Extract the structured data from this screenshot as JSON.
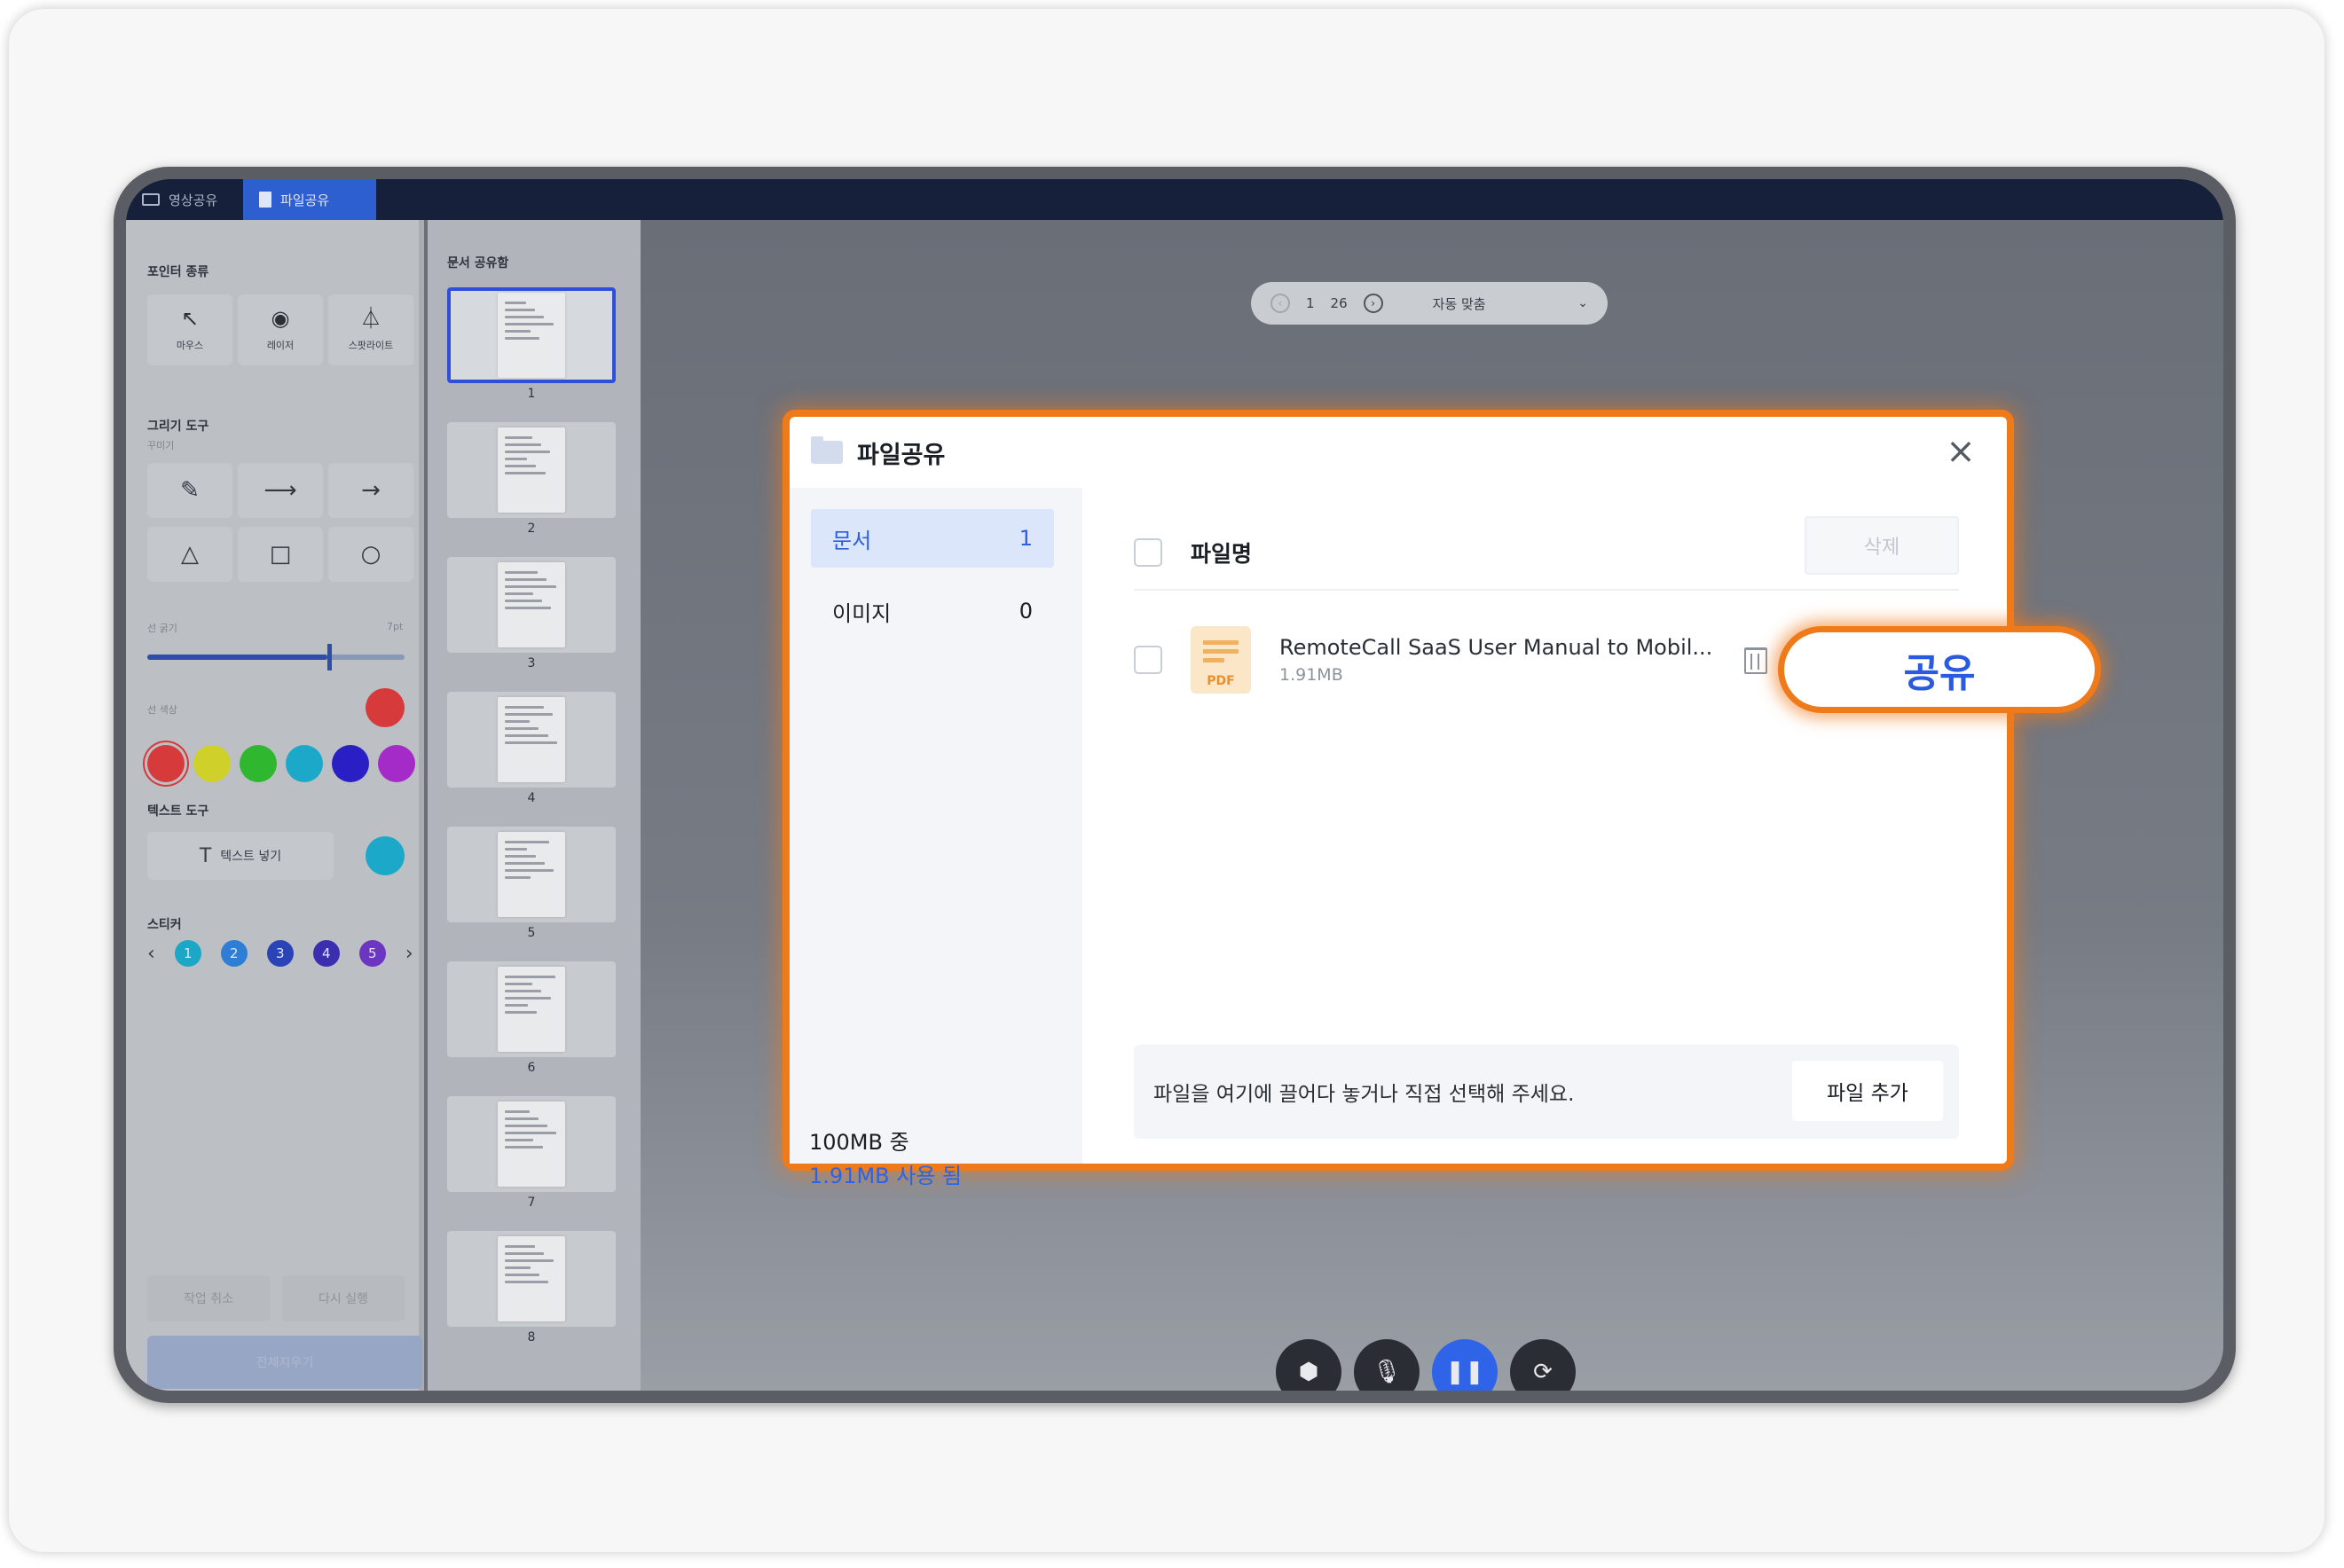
{
  "top_tabs": [
    {
      "label": "영상공유"
    },
    {
      "label": "파일공유"
    }
  ],
  "tool_panel": {
    "pointer_title": "포인터 종류",
    "pointers": [
      {
        "label": "마우스",
        "icon": "cursor-icon"
      },
      {
        "label": "레이저",
        "icon": "laser-icon"
      },
      {
        "label": "스팟라이트",
        "icon": "spotlight-icon"
      }
    ],
    "draw_title": "그리기 도구",
    "draw_sub": "꾸미기",
    "thickness_label": "선 굵기",
    "thickness_value": "7pt",
    "thickness_level": 0.7,
    "color_label": "선 색상",
    "colors": [
      "#d63a3a",
      "#cfd02a",
      "#2fb82f",
      "#1ca9c9",
      "#2a1fc4",
      "#a52bc9"
    ],
    "selected_color": "#d63a3a",
    "text_title": "텍스트 도구",
    "text_button": "텍스트 넣기",
    "text_color": "#1ca9c9",
    "sticker_title": "스티커",
    "stickers": [
      "1",
      "2",
      "3",
      "4",
      "5"
    ],
    "undo": "작업 취소",
    "redo": "다시 실행",
    "reset": "전체지우기"
  },
  "thumbs": {
    "title": "문서 공유함",
    "pages": [
      "1",
      "2",
      "3",
      "4",
      "5",
      "6",
      "7",
      "8"
    ]
  },
  "pager": {
    "current": "1",
    "total": "26",
    "fit": "자동 맞춤"
  },
  "modal": {
    "title": "파일공유",
    "categories": [
      {
        "label": "문서",
        "count": "1"
      },
      {
        "label": "이미지",
        "count": "0"
      }
    ],
    "usage_total": "100MB 중",
    "usage_used": "1.91MB 사용 됨",
    "column_label": "파일명",
    "delete_label": "삭제",
    "files": [
      {
        "name": "RemoteCall SaaS User Manual to Mobil...",
        "size": "1.91MB",
        "type_label": "PDF"
      }
    ],
    "drop_text": "파일을 여기에 끌어다 놓거나 직접 선택해 주세요.",
    "add_file_label": "파일 추가"
  },
  "share_label": "공유",
  "colors": {
    "accent": "#2c5ee0",
    "highlight": "#ef7a1a"
  }
}
